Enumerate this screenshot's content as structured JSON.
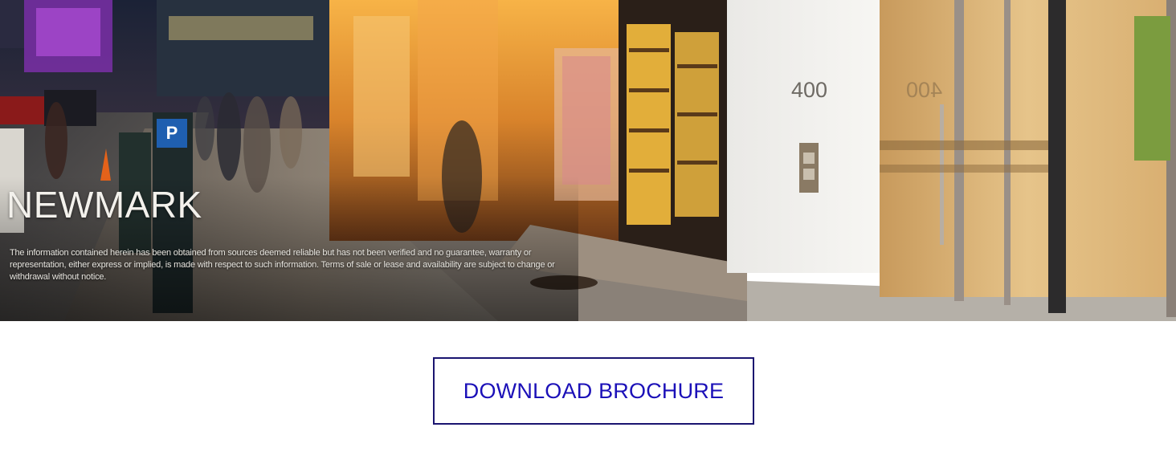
{
  "hero": {
    "brand": "NEWMARK",
    "disclaimer": "The information contained herein has been obtained from sources deemed reliable but has not been verified and no guarantee, warranty or representation, either express or implied, is made with respect to such information. Terms of sale or lease and availability are subject to change or withdrawal without notice.",
    "address_number": "400",
    "address_number_reflection": "400",
    "parking_sign": "P",
    "image_alt": "Street-level photo of a building entrance with storefronts at night"
  },
  "actions": {
    "download_label": "DOWNLOAD BROCHURE"
  },
  "colors": {
    "button_border": "#1a1470",
    "button_text": "#1b10b8",
    "page_background": "#ffffff"
  }
}
